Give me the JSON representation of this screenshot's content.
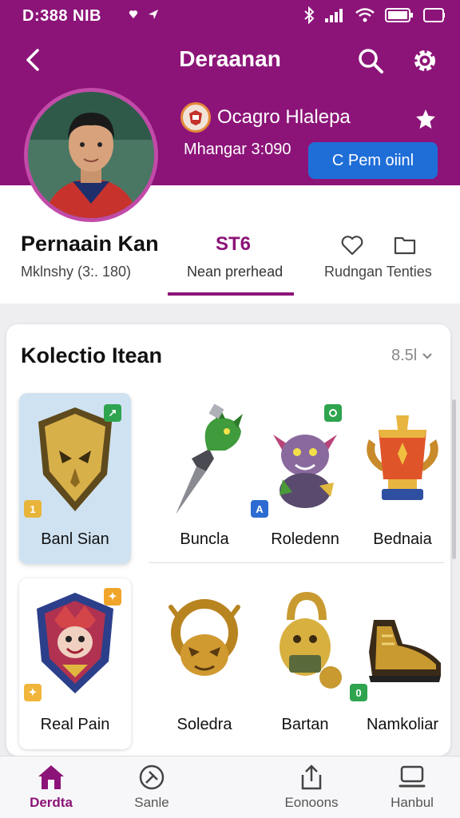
{
  "status_bar": {
    "time": "D:388 NIB"
  },
  "header": {
    "title": "Deraanan",
    "club_name": "Ocagro Hlalepa",
    "subtext": "Mhangar 3:090",
    "button_label": "C Pem oiinl"
  },
  "profile": {
    "name": "Pernaain Kan",
    "subtitle": "Mklnshy (3:. 180)",
    "tab_value": "ST6",
    "tab_label": "Nean prerhead",
    "side_label": "Rudngan Tenties"
  },
  "collection": {
    "title": "Kolectio Itean",
    "sort_value": "8.5l",
    "items": [
      {
        "label": "Banl Sian",
        "icon": "golden-shield-mask-icon",
        "badge": "↗",
        "badge2": "1"
      },
      {
        "label": "Buncla",
        "icon": "green-dragon-dagger-icon"
      },
      {
        "label": "Roledenn",
        "icon": "purple-goblin-icon",
        "badge": "A"
      },
      {
        "label": "Bednaia",
        "icon": "red-trophy-icon"
      },
      {
        "label": "Real Pain",
        "icon": "jester-shield-icon",
        "badge": "✦",
        "badge2": "✦"
      },
      {
        "label": "Soledra",
        "icon": "golden-ring-mask-icon"
      },
      {
        "label": "Bartan",
        "icon": "golden-lock-icon"
      },
      {
        "label": "Namkoliar",
        "icon": "golden-shoe-icon",
        "badge": "0"
      }
    ]
  },
  "nav": {
    "items": [
      {
        "label": "Derdta",
        "icon": "home-icon",
        "active": true
      },
      {
        "label": "Sanle",
        "icon": "compass-icon"
      },
      {
        "label": "Eonoons",
        "icon": "share-icon"
      },
      {
        "label": "Hanbul",
        "icon": "monitor-icon"
      }
    ]
  },
  "colors": {
    "brand": "#8c1478",
    "accent": "#1f6ed8",
    "selected_bg": "#cfe2f1"
  }
}
